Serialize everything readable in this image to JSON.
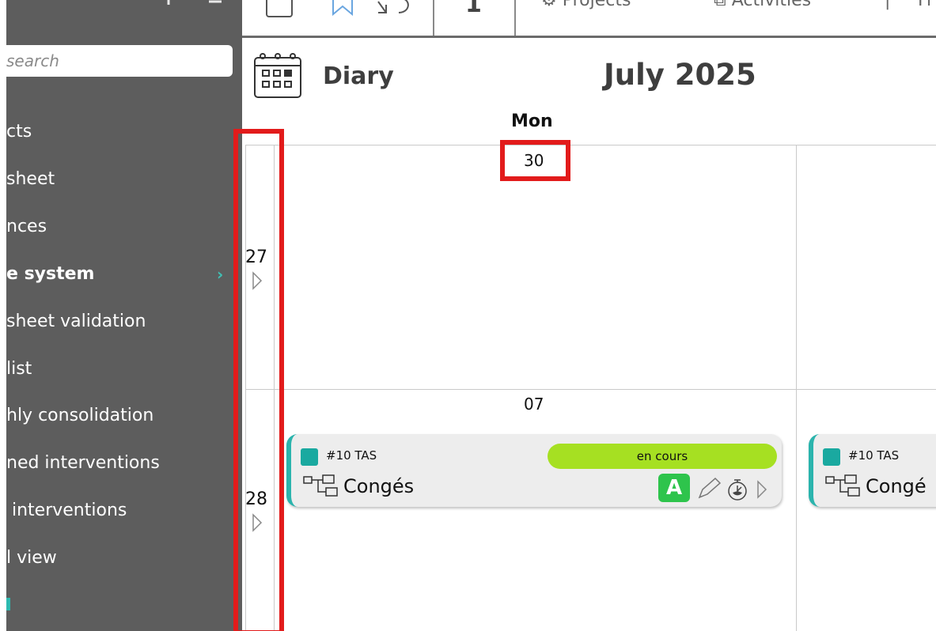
{
  "sidebar": {
    "search_placeholder": "search",
    "items": [
      {
        "label": "cts",
        "bold": false
      },
      {
        "label": "sheet",
        "bold": false
      },
      {
        "label": "nces",
        "bold": false
      },
      {
        "label": "e system",
        "bold": true,
        "has_submenu": true
      },
      {
        "label": "sheet validation",
        "bold": false
      },
      {
        "label": "list",
        "bold": false
      },
      {
        "label": "hly consolidation",
        "bold": false
      },
      {
        "label": "ned interventions",
        "bold": false
      },
      {
        "label": " interventions",
        "bold": false
      },
      {
        "label": "l view",
        "bold": false
      }
    ]
  },
  "toolbar": {
    "counter": "1",
    "projects_label": "Projects",
    "activities_label": "Activities",
    "more_label": "Fi"
  },
  "diary": {
    "title": "Diary",
    "month": "July 2025",
    "day_header": "Mon"
  },
  "weeks": [
    {
      "week": "27",
      "date": "30"
    },
    {
      "week": "28",
      "date": "07"
    }
  ],
  "events": [
    {
      "code": "#10 TAS",
      "name": "Congés",
      "status": "en cours",
      "badge": "A"
    },
    {
      "code": "#10 TAS",
      "name": "Congé"
    }
  ],
  "colors": {
    "sidebar_bg": "#5d5d5d",
    "accent_teal": "#1aa9a0",
    "status_green": "#a6e022",
    "badge_green": "#2ec44c",
    "highlight_red": "#e21b1b"
  }
}
